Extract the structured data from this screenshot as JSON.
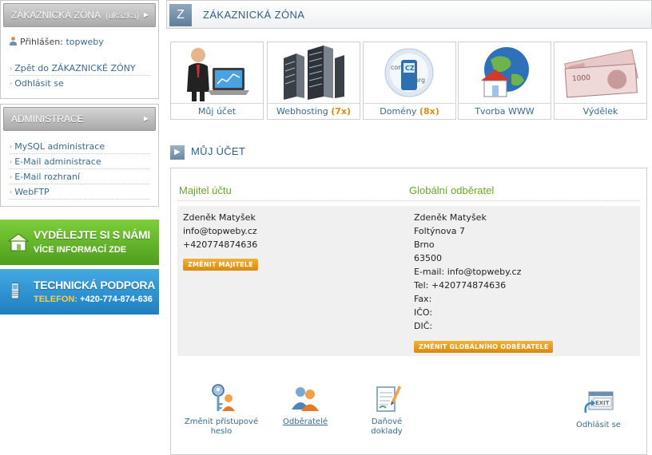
{
  "sidebar": {
    "zone": {
      "title": "ZÁKAZNICKÁ ZÓNA",
      "subtitle": "(ukázka)",
      "logged_in_label": "Přihlášen:",
      "user": "topweby",
      "links": [
        "Zpět do ZÁKAZNICKÉ ZÓNY",
        "Odhlásit se"
      ]
    },
    "admin": {
      "title": "ADMINISTRACE",
      "links": [
        "MySQL administrace",
        "E-Mail administrace",
        "E-Mail rozhraní",
        "WebFTP"
      ]
    },
    "banner_earn": {
      "title": "VYDĚLEJTE SI S NÁMI",
      "subtitle": "VÍCE INFORMACÍ ZDE"
    },
    "banner_support": {
      "title": "TECHNICKÁ PODPORA",
      "phone_label": "TELEFON:",
      "phone": "+420-774-874-636"
    }
  },
  "header": {
    "icon_letter": "Z",
    "title": "ZÁKAZNICKÁ ZÓNA"
  },
  "tiles": [
    {
      "label": "Můj účet",
      "count": ""
    },
    {
      "label": "Webhosting",
      "count": "(7x)"
    },
    {
      "label": "Domény",
      "count": "(8x)"
    },
    {
      "label": "Tvorba WWW",
      "count": ""
    },
    {
      "label": "Výdělek",
      "count": ""
    }
  ],
  "account": {
    "section_title": "MŮJ ÚČET",
    "owner": {
      "heading": "Majitel účtu",
      "name": "Zdeněk Matyšek",
      "email": "info@topweby.cz",
      "phone": "+420774874636",
      "button": "ZMĚNIT MAJITELE"
    },
    "billing": {
      "heading": "Globální odběratel",
      "name": "Zdeněk Matyšek",
      "street": "Foltýnova 7",
      "city": "Brno",
      "zip": "63500",
      "email_line": "E-mail: info@topweby.cz",
      "tel_line": "Tel: +420774874636",
      "fax_line": "Fax:",
      "ico_line": "IČO:",
      "dic_line": "DIČ:",
      "button": "ZMĚNIT GLOBÁLNÍHO ODBĚRATELE"
    }
  },
  "actions": {
    "change_password": [
      "Změnit přístupové",
      "heslo"
    ],
    "customers": "Odběratelé",
    "tax_docs": [
      "Daňové",
      "doklady"
    ],
    "logout": "Odhlásit se"
  },
  "colors": {
    "accent_blue": "#2e5f84",
    "link": "#3a6a8c",
    "green_heading": "#6aa52e",
    "orange_button": "#d98a0c",
    "banner_green": "#5fb52a",
    "banner_blue": "#2b92d3"
  }
}
